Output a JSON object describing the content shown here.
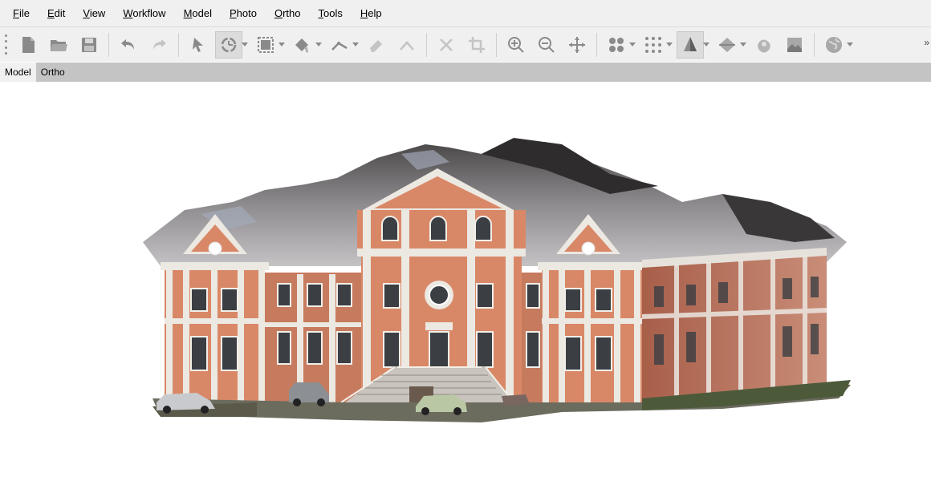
{
  "menubar": {
    "items": [
      {
        "mnemonic": "F",
        "rest": "ile"
      },
      {
        "mnemonic": "E",
        "rest": "dit"
      },
      {
        "mnemonic": "V",
        "rest": "iew"
      },
      {
        "mnemonic": "W",
        "rest": "orkflow"
      },
      {
        "mnemonic": "M",
        "rest": "odel"
      },
      {
        "mnemonic": "P",
        "rest": "hoto"
      },
      {
        "mnemonic": "O",
        "rest": "rtho"
      },
      {
        "mnemonic": "T",
        "rest": "ools"
      },
      {
        "mnemonic": "H",
        "rest": "elp"
      }
    ]
  },
  "toolbar": {
    "icons": [
      "new-document-icon",
      "open-folder-icon",
      "save-icon",
      "undo-icon",
      "redo-icon",
      "pointer-icon",
      "rotate-object-icon",
      "rectangle-selection-icon",
      "paint-selection-icon",
      "ruler-icon",
      "eraser-icon",
      "draw-line-icon",
      "delete-icon",
      "crop-icon",
      "zoom-in-icon",
      "zoom-out-icon",
      "reset-view-icon",
      "point-cloud-icon",
      "dense-cloud-icon",
      "shaded-model-icon",
      "textured-model-icon",
      "tiled-model-icon",
      "orthomosaic-icon",
      "globe-icon"
    ],
    "overflow": "»"
  },
  "tabs": [
    {
      "label": "Model",
      "active": true
    },
    {
      "label": "Ortho",
      "active": false
    }
  ],
  "colors": {
    "menubar_bg": "#f0f0f0",
    "tabbar_bg": "#c4c4c4",
    "icon_gray": "#8a8a8a",
    "facade_salmon": "#d98867",
    "facade_white": "#ece8e2",
    "roof": "#6b6a6c"
  }
}
